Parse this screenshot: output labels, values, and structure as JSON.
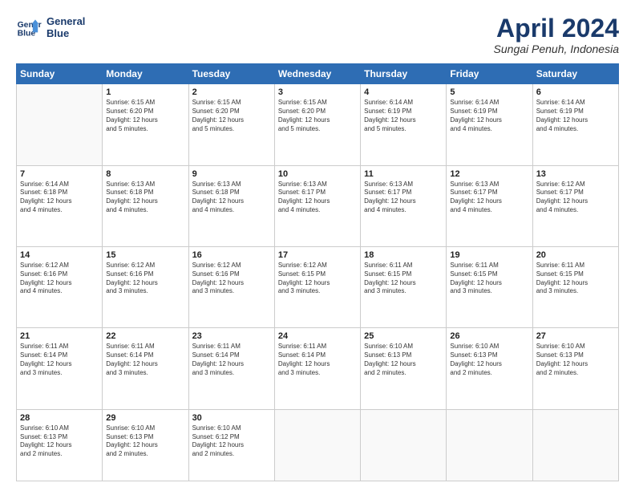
{
  "header": {
    "logo_line1": "General",
    "logo_line2": "Blue",
    "title": "April 2024",
    "subtitle": "Sungai Penuh, Indonesia"
  },
  "weekdays": [
    "Sunday",
    "Monday",
    "Tuesday",
    "Wednesday",
    "Thursday",
    "Friday",
    "Saturday"
  ],
  "weeks": [
    [
      {
        "day": "",
        "info": ""
      },
      {
        "day": "1",
        "info": "Sunrise: 6:15 AM\nSunset: 6:20 PM\nDaylight: 12 hours\nand 5 minutes."
      },
      {
        "day": "2",
        "info": "Sunrise: 6:15 AM\nSunset: 6:20 PM\nDaylight: 12 hours\nand 5 minutes."
      },
      {
        "day": "3",
        "info": "Sunrise: 6:15 AM\nSunset: 6:20 PM\nDaylight: 12 hours\nand 5 minutes."
      },
      {
        "day": "4",
        "info": "Sunrise: 6:14 AM\nSunset: 6:19 PM\nDaylight: 12 hours\nand 5 minutes."
      },
      {
        "day": "5",
        "info": "Sunrise: 6:14 AM\nSunset: 6:19 PM\nDaylight: 12 hours\nand 4 minutes."
      },
      {
        "day": "6",
        "info": "Sunrise: 6:14 AM\nSunset: 6:19 PM\nDaylight: 12 hours\nand 4 minutes."
      }
    ],
    [
      {
        "day": "7",
        "info": "Sunrise: 6:14 AM\nSunset: 6:18 PM\nDaylight: 12 hours\nand 4 minutes."
      },
      {
        "day": "8",
        "info": "Sunrise: 6:13 AM\nSunset: 6:18 PM\nDaylight: 12 hours\nand 4 minutes."
      },
      {
        "day": "9",
        "info": "Sunrise: 6:13 AM\nSunset: 6:18 PM\nDaylight: 12 hours\nand 4 minutes."
      },
      {
        "day": "10",
        "info": "Sunrise: 6:13 AM\nSunset: 6:17 PM\nDaylight: 12 hours\nand 4 minutes."
      },
      {
        "day": "11",
        "info": "Sunrise: 6:13 AM\nSunset: 6:17 PM\nDaylight: 12 hours\nand 4 minutes."
      },
      {
        "day": "12",
        "info": "Sunrise: 6:13 AM\nSunset: 6:17 PM\nDaylight: 12 hours\nand 4 minutes."
      },
      {
        "day": "13",
        "info": "Sunrise: 6:12 AM\nSunset: 6:17 PM\nDaylight: 12 hours\nand 4 minutes."
      }
    ],
    [
      {
        "day": "14",
        "info": "Sunrise: 6:12 AM\nSunset: 6:16 PM\nDaylight: 12 hours\nand 4 minutes."
      },
      {
        "day": "15",
        "info": "Sunrise: 6:12 AM\nSunset: 6:16 PM\nDaylight: 12 hours\nand 3 minutes."
      },
      {
        "day": "16",
        "info": "Sunrise: 6:12 AM\nSunset: 6:16 PM\nDaylight: 12 hours\nand 3 minutes."
      },
      {
        "day": "17",
        "info": "Sunrise: 6:12 AM\nSunset: 6:15 PM\nDaylight: 12 hours\nand 3 minutes."
      },
      {
        "day": "18",
        "info": "Sunrise: 6:11 AM\nSunset: 6:15 PM\nDaylight: 12 hours\nand 3 minutes."
      },
      {
        "day": "19",
        "info": "Sunrise: 6:11 AM\nSunset: 6:15 PM\nDaylight: 12 hours\nand 3 minutes."
      },
      {
        "day": "20",
        "info": "Sunrise: 6:11 AM\nSunset: 6:15 PM\nDaylight: 12 hours\nand 3 minutes."
      }
    ],
    [
      {
        "day": "21",
        "info": "Sunrise: 6:11 AM\nSunset: 6:14 PM\nDaylight: 12 hours\nand 3 minutes."
      },
      {
        "day": "22",
        "info": "Sunrise: 6:11 AM\nSunset: 6:14 PM\nDaylight: 12 hours\nand 3 minutes."
      },
      {
        "day": "23",
        "info": "Sunrise: 6:11 AM\nSunset: 6:14 PM\nDaylight: 12 hours\nand 3 minutes."
      },
      {
        "day": "24",
        "info": "Sunrise: 6:11 AM\nSunset: 6:14 PM\nDaylight: 12 hours\nand 3 minutes."
      },
      {
        "day": "25",
        "info": "Sunrise: 6:10 AM\nSunset: 6:13 PM\nDaylight: 12 hours\nand 2 minutes."
      },
      {
        "day": "26",
        "info": "Sunrise: 6:10 AM\nSunset: 6:13 PM\nDaylight: 12 hours\nand 2 minutes."
      },
      {
        "day": "27",
        "info": "Sunrise: 6:10 AM\nSunset: 6:13 PM\nDaylight: 12 hours\nand 2 minutes."
      }
    ],
    [
      {
        "day": "28",
        "info": "Sunrise: 6:10 AM\nSunset: 6:13 PM\nDaylight: 12 hours\nand 2 minutes."
      },
      {
        "day": "29",
        "info": "Sunrise: 6:10 AM\nSunset: 6:13 PM\nDaylight: 12 hours\nand 2 minutes."
      },
      {
        "day": "30",
        "info": "Sunrise: 6:10 AM\nSunset: 6:12 PM\nDaylight: 12 hours\nand 2 minutes."
      },
      {
        "day": "",
        "info": ""
      },
      {
        "day": "",
        "info": ""
      },
      {
        "day": "",
        "info": ""
      },
      {
        "day": "",
        "info": ""
      }
    ]
  ]
}
